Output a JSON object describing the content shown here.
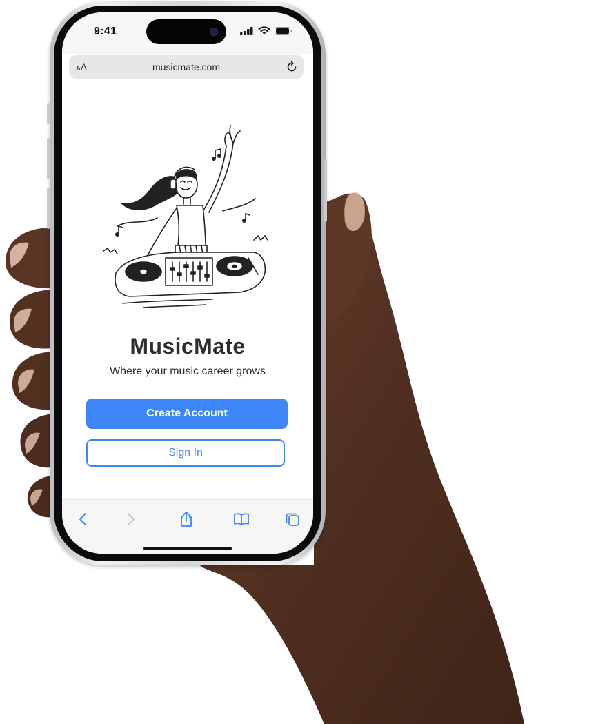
{
  "status_bar": {
    "time": "9:41"
  },
  "browser": {
    "text_size_small": "A",
    "text_size_large": "A",
    "url": "musicmate.com"
  },
  "app": {
    "title": "MusicMate",
    "tagline": "Where your music career grows",
    "create_account_label": "Create Account",
    "sign_in_label": "Sign In"
  },
  "toolbar": {
    "icons": [
      "back-icon",
      "forward-icon",
      "share-icon",
      "bookmarks-icon",
      "tabs-icon"
    ]
  },
  "colors": {
    "accent": "#3d86f7",
    "title_text": "#2e2e2e",
    "skin": "#5a3424"
  }
}
